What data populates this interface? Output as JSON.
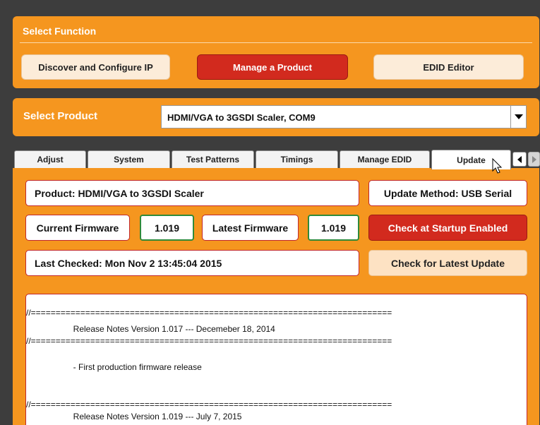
{
  "select_function": {
    "title": "Select Function",
    "buttons": [
      {
        "label": "Discover and Configure IP",
        "active": false
      },
      {
        "label": "Manage a Product",
        "active": true
      },
      {
        "label": "EDID Editor",
        "active": false
      }
    ]
  },
  "select_product": {
    "label": "Select Product",
    "value": "HDMI/VGA to 3GSDI Scaler, COM9"
  },
  "tabs": [
    {
      "label": "Adjust"
    },
    {
      "label": "System"
    },
    {
      "label": "Test Patterns"
    },
    {
      "label": "Timings"
    },
    {
      "label": "Manage EDID"
    },
    {
      "label": "Update",
      "selected": true
    }
  ],
  "update": {
    "product": "Product: HDMI/VGA to 3GSDI Scaler",
    "update_method": "Update Method: USB Serial",
    "current_firmware_label": "Current Firmware",
    "current_firmware_value": "1.019",
    "latest_firmware_label": "Latest Firmware",
    "latest_firmware_value": "1.019",
    "check_startup_button": "Check at Startup Enabled",
    "last_checked": "Last Checked: Mon Nov 2 13:45:04 2015",
    "check_latest_button": "Check for Latest Update"
  },
  "release_notes": {
    "separator": "//=========================================================================",
    "lines": [
      "                    Release Notes Version 1.017 --- Decemeber 18, 2014",
      "                    - First production firmware release",
      "                    Release Notes Version 1.019 --- July 7, 2015"
    ]
  },
  "colors": {
    "panel_orange": "#f5961f",
    "active_red": "#d22a1e",
    "border_red": "#c0272d",
    "version_green": "#2f8a3a"
  }
}
